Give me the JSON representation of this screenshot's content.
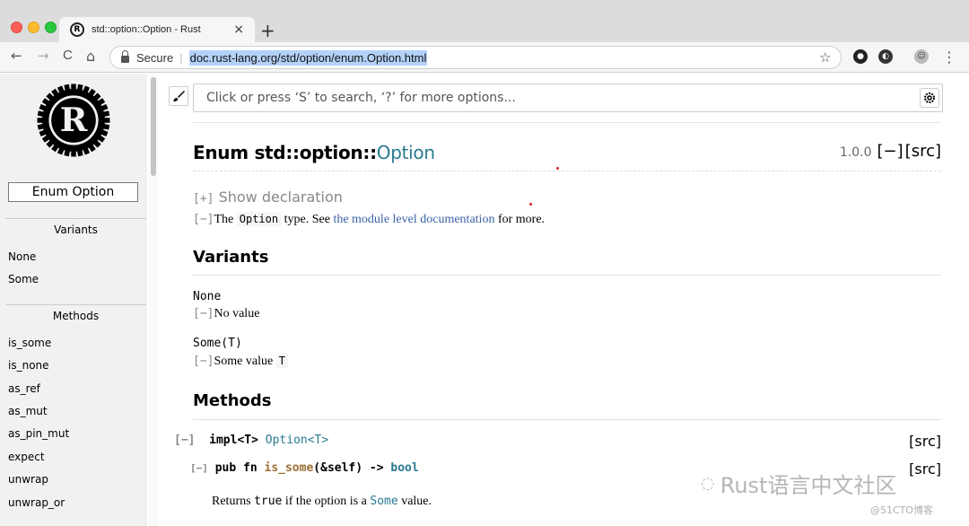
{
  "browser": {
    "tab_title": "std::option::Option - Rust",
    "tab_close": "×",
    "new_tab": "+",
    "nav": {
      "back": "←",
      "forward": "→",
      "reload": "C",
      "home": "⌂"
    },
    "secure_label": "Secure",
    "separator": "|",
    "url": "doc.rust-lang.org/std/option/enum.Option.html",
    "star": "☆",
    "menu": "⋮"
  },
  "sidebar": {
    "crate_box": "Enum Option",
    "variants_heading": "Variants",
    "variants": [
      "None",
      "Some"
    ],
    "methods_heading": "Methods",
    "methods": [
      "is_some",
      "is_none",
      "as_ref",
      "as_mut",
      "as_pin_mut",
      "expect",
      "unwrap",
      "unwrap_or"
    ]
  },
  "search": {
    "placeholder": "Click or press ‘S’ to search, ‘?’ for more options..."
  },
  "header": {
    "prefix": "Enum std::option::",
    "name": "Option",
    "since": "1.0.0",
    "collapse": "[−]",
    "src": "[src]"
  },
  "declaration": {
    "toggle": "[+]",
    "label": "Show declaration"
  },
  "doc": {
    "toggle": "[−]",
    "the": "The ",
    "type_code": "Option",
    "text1": " type. See ",
    "link": "the module level documentation",
    "text2": " for more."
  },
  "variants_section": {
    "title": "Variants",
    "items": [
      {
        "name": "None",
        "toggle": "[−]",
        "doc": "No value",
        "code": ""
      },
      {
        "name": "Some(T)",
        "toggle": "[−]",
        "doc": "Some value ",
        "code": "T"
      }
    ]
  },
  "methods_section": {
    "title": "Methods",
    "impl_toggle": "[−]",
    "impl_kw": "impl<T> ",
    "impl_type": "Option<T>",
    "impl_src": "[src]",
    "method_toggle": "[−]",
    "method_sig_kw": "pub fn ",
    "method_name": "is_some",
    "method_args": "(&self) -> ",
    "method_ret": "bool",
    "method_src": "[src]",
    "method_doc_pre": "Returns ",
    "method_doc_code": "true",
    "method_doc_mid": " if the option is a ",
    "method_doc_link": "Some",
    "method_doc_post": " value."
  },
  "watermark": {
    "main": "Rust语言中文社区",
    "sub": "@51CTO博客"
  },
  "colors": {
    "link": "#3b62a6",
    "type": "#2a7a90",
    "fn": "#9a6e31",
    "sidebar_bg": "#f1f1f1"
  }
}
